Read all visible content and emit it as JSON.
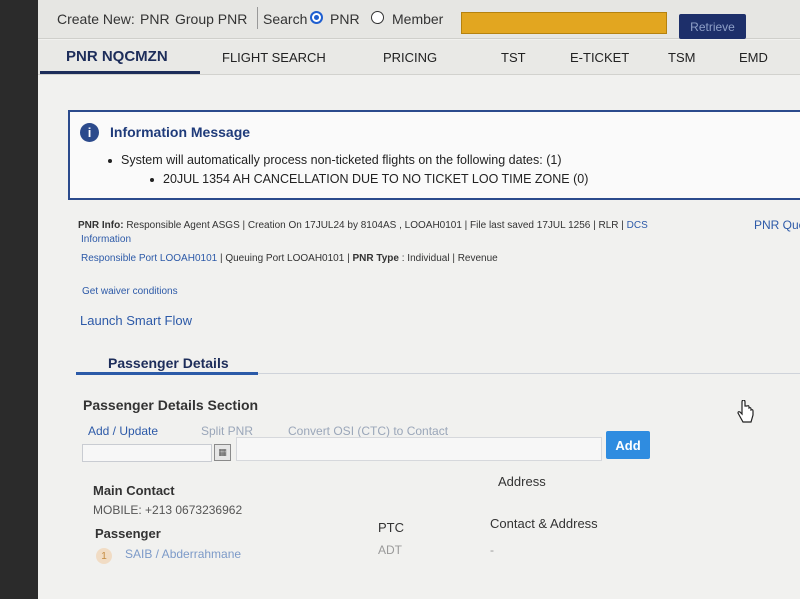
{
  "topbar": {
    "create_new": "Create New:",
    "pnr": "PNR",
    "group_pnr": "Group PNR",
    "search": "Search",
    "radio_pnr": "PNR",
    "radio_member": "Member",
    "search_value": "",
    "retrieve": "Retrieve"
  },
  "tabs": [
    "PNR NQCMZN",
    "FLIGHT SEARCH",
    "PRICING",
    "TST",
    "E-TICKET",
    "TSM",
    "EMD"
  ],
  "info": {
    "icon": "i",
    "title": "Information Message",
    "line1": "System will automatically process non-ticketed flights on the following dates: (1)",
    "line2": "20JUL 1354 AH CANCELLATION DUE TO NO TICKET LOO TIME ZONE (0)"
  },
  "pnr_info": {
    "label": "PNR Info:",
    "text": " Responsible Agent ASGS | Creation On 17JUL24 by 8104AS , LOOAH0101 | File last saved 17JUL 1256 | RLR | ",
    "dcs": "DCS",
    "dcs2": "Information",
    "pnr_que": "PNR Que",
    "resp_port": "Responsible Port LOOAH0101",
    "queuing": " | Queuing Port LOOAH0101 | ",
    "pnr_type_label": "PNR Type",
    "pnr_type": " : Individual | Revenue",
    "waiver": "Get waiver conditions",
    "smart_flow": "Launch Smart Flow"
  },
  "passenger": {
    "tab": "Passenger Details",
    "section_title": "Passenger Details Section",
    "add_update": "Add / Update",
    "split_pnr": "Split PNR",
    "convert_osi": "Convert OSI (CTC) to Contact",
    "add": "Add",
    "main_contact": "Main Contact",
    "address": "Address",
    "mobile": "MOBILE: +213 0673236962",
    "passenger_label": "Passenger",
    "ptc_label": "PTC",
    "contact_address": "Contact & Address",
    "pax_number": "1",
    "pax_name": "SAIB / Abderrahmane",
    "pax_ptc": "ADT",
    "pax_contact": "-"
  }
}
